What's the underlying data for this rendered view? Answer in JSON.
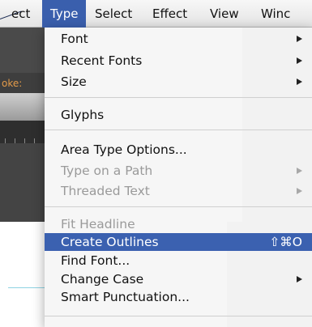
{
  "menubar": {
    "items": [
      {
        "label": "ect"
      },
      {
        "label": "Type"
      },
      {
        "label": "Select"
      },
      {
        "label": "Effect"
      },
      {
        "label": "View"
      },
      {
        "label": "Winc"
      }
    ]
  },
  "background_app": {
    "stroke_label": "oke:"
  },
  "type_menu": {
    "items": [
      {
        "label": "Font"
      },
      {
        "label": "Recent Fonts"
      },
      {
        "label": "Size"
      },
      {
        "label": "Glyphs"
      },
      {
        "label": "Area Type Options..."
      },
      {
        "label": "Type on a Path"
      },
      {
        "label": "Threaded Text"
      },
      {
        "label": "Fit Headline"
      },
      {
        "label": "Create Outlines",
        "shortcut": "⇧⌘O"
      },
      {
        "label": "Find Font..."
      },
      {
        "label": "Change Case"
      },
      {
        "label": "Smart Punctuation..."
      }
    ]
  },
  "colors": {
    "highlight": "#3b61b0",
    "menubar_active": "#3a5fad",
    "stroke_label": "#e39b4a"
  }
}
